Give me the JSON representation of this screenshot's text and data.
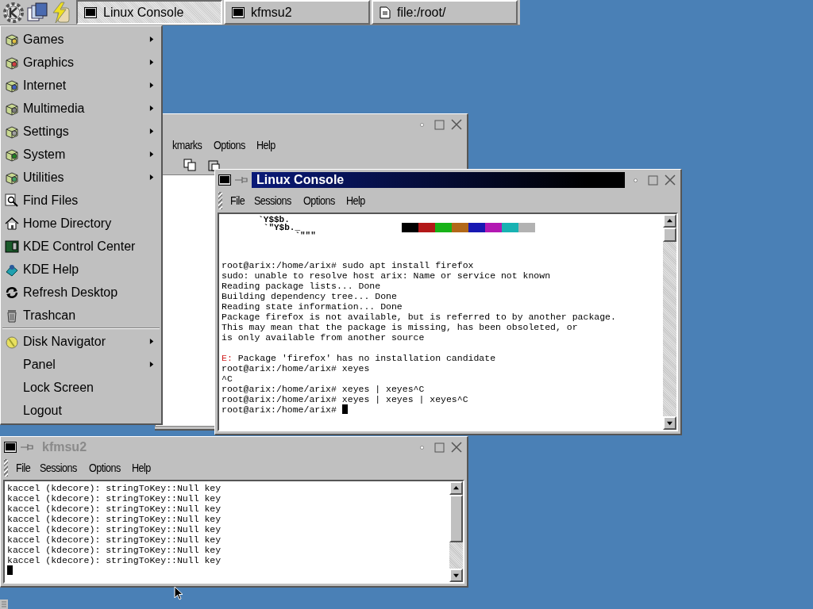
{
  "taskbar": {
    "tasks": [
      {
        "label": "Linux Console",
        "kind": "terminal",
        "selected": true
      },
      {
        "label": "kfmsu2",
        "kind": "terminal",
        "selected": false
      },
      {
        "label": "file:/root/",
        "kind": "document",
        "selected": false
      }
    ]
  },
  "start_menu": {
    "groups": [
      {
        "items": [
          {
            "label": "Games",
            "has_submenu": true
          },
          {
            "label": "Graphics",
            "has_submenu": true
          },
          {
            "label": "Internet",
            "has_submenu": true
          },
          {
            "label": "Multimedia",
            "has_submenu": true
          },
          {
            "label": "Settings",
            "has_submenu": true
          },
          {
            "label": "System",
            "has_submenu": true
          },
          {
            "label": "Utilities",
            "has_submenu": true
          },
          {
            "label": "Find Files",
            "has_submenu": false
          },
          {
            "label": "Home Directory",
            "has_submenu": false
          },
          {
            "label": "KDE Control Center",
            "has_submenu": false
          },
          {
            "label": "KDE Help",
            "has_submenu": false
          },
          {
            "label": "Refresh Desktop",
            "has_submenu": false
          },
          {
            "label": "Trashcan",
            "has_submenu": false
          }
        ]
      },
      {
        "items": [
          {
            "label": "Disk Navigator",
            "has_submenu": true
          },
          {
            "label": "Panel",
            "has_submenu": true
          },
          {
            "label": "Lock Screen",
            "has_submenu": false
          },
          {
            "label": "Logout",
            "has_submenu": false
          }
        ]
      }
    ]
  },
  "file_manager_window": {
    "menu": [
      "kmarks",
      "Options",
      "Help"
    ]
  },
  "console_window": {
    "title": "Linux Console",
    "active": true,
    "menu": [
      "File",
      "Sessions",
      "Options",
      "Help"
    ],
    "art": [
      "       `Y$$b.",
      "        `\"Y$b._",
      "              `\"\"\""
    ],
    "palette": [
      {
        "color": "#000000"
      },
      {
        "color": "#b21818"
      },
      {
        "color": "#18b218"
      },
      {
        "color": "#b26818"
      },
      {
        "color": "#1818b2"
      },
      {
        "color": "#b218b2"
      },
      {
        "color": "#18b2b2"
      },
      {
        "color": "#b2b2b2"
      }
    ],
    "lines": [
      {
        "kind": "blank"
      },
      {
        "kind": "blank"
      },
      {
        "kind": "text",
        "text": "root@arix:/home/arix# sudo apt install firefox"
      },
      {
        "kind": "text",
        "text": "sudo: unable to resolve host arix: Name or service not known"
      },
      {
        "kind": "text",
        "text": "Reading package lists... Done"
      },
      {
        "kind": "text",
        "text": "Building dependency tree... Done"
      },
      {
        "kind": "text",
        "text": "Reading state information... Done"
      },
      {
        "kind": "text",
        "text": "Package firefox is not available, but is referred to by another package."
      },
      {
        "kind": "text",
        "text": "This may mean that the package is missing, has been obsoleted, or"
      },
      {
        "kind": "text",
        "text": "is only available from another source"
      },
      {
        "kind": "blank"
      },
      {
        "kind": "error",
        "prefix": "E:",
        "text": " Package 'firefox' has no installation candidate"
      },
      {
        "kind": "text",
        "text": "root@arix:/home/arix# xeyes"
      },
      {
        "kind": "text",
        "text": "^C"
      },
      {
        "kind": "text",
        "text": "root@arix:/home/arix# xeyes | xeyes^C"
      },
      {
        "kind": "text",
        "text": "root@arix:/home/arix# xeyes | xeyes | xeyes^C"
      },
      {
        "kind": "prompt",
        "text": "root@arix:/home/arix# "
      }
    ]
  },
  "kfmsu2_window": {
    "title": "kfmsu2",
    "active": false,
    "menu": [
      "File",
      "Sessions",
      "Options",
      "Help"
    ],
    "lines": [
      {
        "kind": "text",
        "text": "kaccel (kdecore): stringToKey::Null key"
      },
      {
        "kind": "text",
        "text": "kaccel (kdecore): stringToKey::Null key"
      },
      {
        "kind": "text",
        "text": "kaccel (kdecore): stringToKey::Null key"
      },
      {
        "kind": "text",
        "text": "kaccel (kdecore): stringToKey::Null key"
      },
      {
        "kind": "text",
        "text": "kaccel (kdecore): stringToKey::Null key"
      },
      {
        "kind": "text",
        "text": "kaccel (kdecore): stringToKey::Null key"
      },
      {
        "kind": "text",
        "text": "kaccel (kdecore): stringToKey::Null key"
      },
      {
        "kind": "text",
        "text": "kaccel (kdecore): stringToKey::Null key"
      },
      {
        "kind": "prompt"
      }
    ]
  }
}
